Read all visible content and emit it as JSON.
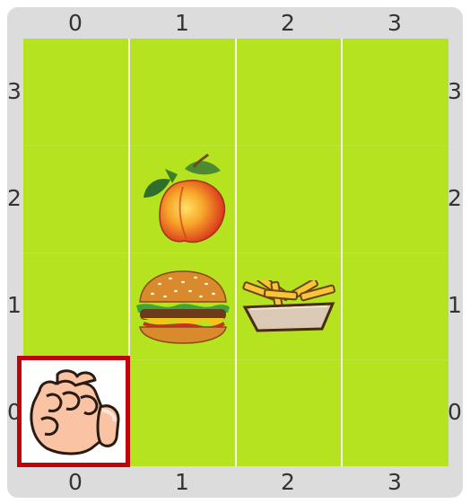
{
  "board": {
    "columns": [
      "0",
      "1",
      "2",
      "3"
    ],
    "rows": [
      "3",
      "2",
      "1",
      "0"
    ],
    "colors": {
      "field": "#b5e31f",
      "frame": "#dcdcdc",
      "cursor_border": "#c0050a"
    }
  },
  "items": [
    {
      "name": "peach-icon",
      "col": 1,
      "row": 2
    },
    {
      "name": "hamburger-icon",
      "col": 1,
      "row": 1
    },
    {
      "name": "fries-icon",
      "col": 2,
      "row": 1
    }
  ],
  "cursor": {
    "icon": "pointing-hand-icon",
    "col": 0,
    "row": 0
  }
}
